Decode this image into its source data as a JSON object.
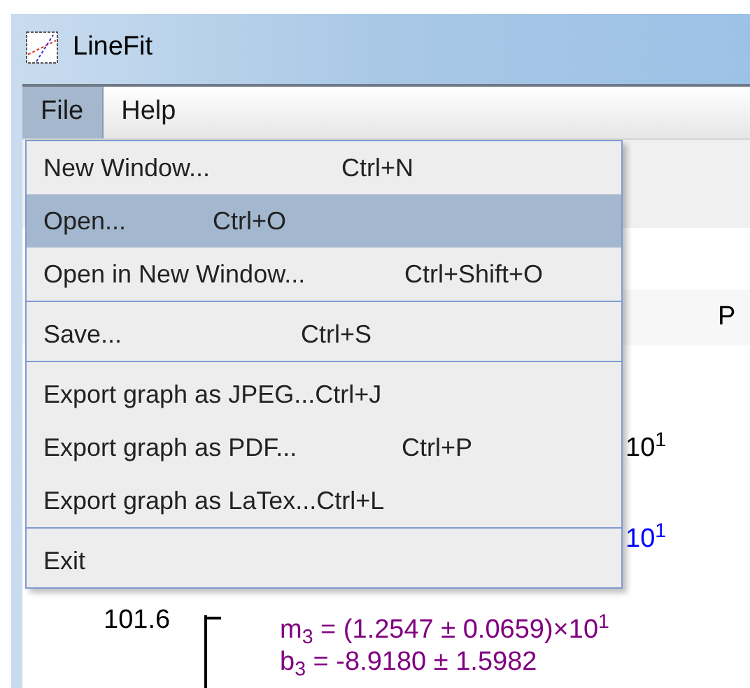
{
  "window": {
    "title": "LineFit"
  },
  "menu_bar": [
    {
      "label": "File",
      "selected": true
    },
    {
      "label": "Help",
      "selected": false
    }
  ],
  "file_menu": [
    {
      "kind": "item",
      "label": "New Window...",
      "shortcut": "Ctrl+N",
      "selected": false
    },
    {
      "kind": "item",
      "label": "Open...",
      "shortcut": "Ctrl+O",
      "selected": true
    },
    {
      "kind": "item",
      "label": "Open in New Window...",
      "shortcut": "Ctrl+Shift+O",
      "selected": false
    },
    {
      "kind": "separator"
    },
    {
      "kind": "item",
      "label": "Save...",
      "shortcut": "Ctrl+S",
      "selected": false
    },
    {
      "kind": "separator"
    },
    {
      "kind": "item",
      "label": "Export graph as JPEG...",
      "shortcut": "Ctrl+J",
      "selected": false
    },
    {
      "kind": "item",
      "label": "Export graph as PDF...",
      "shortcut": "Ctrl+P",
      "selected": false
    },
    {
      "kind": "item",
      "label": "Export graph as LaTex...",
      "shortcut": "Ctrl+L",
      "selected": false
    },
    {
      "kind": "separator"
    },
    {
      "kind": "item",
      "label": "Exit",
      "selected": false
    }
  ],
  "table_header": {
    "column_2": "P"
  },
  "graph": {
    "y_tick": "101.6",
    "fit_labels": [
      {
        "text": "10$^{1}$",
        "color": "#000000"
      },
      {
        "text": "10$^{1}$",
        "color": "#0000ff"
      },
      {
        "text": "m$_{3}$ = (1.2547 ± 0.0659)×10$^{1}$",
        "color": "#800080"
      },
      {
        "text": "b$_{3}$ = -8.9180 ± 1.5982",
        "color": "#800080"
      }
    ]
  }
}
